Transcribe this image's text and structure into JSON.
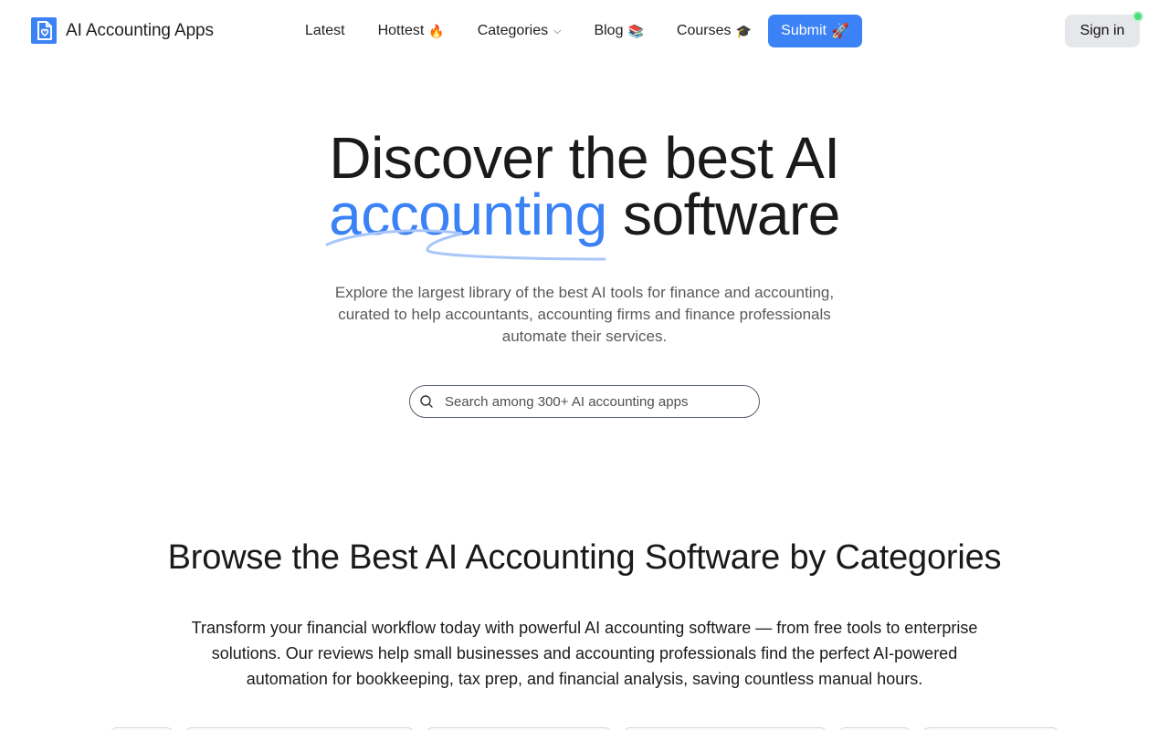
{
  "brand": {
    "name": "AI Accounting Apps",
    "accent": "#3b82f6"
  },
  "nav": {
    "items": [
      {
        "label": "Latest",
        "emoji": ""
      },
      {
        "label": "Hottest",
        "emoji": "🔥"
      },
      {
        "label": "Categories",
        "emoji": ""
      },
      {
        "label": "Blog",
        "emoji": "📚"
      },
      {
        "label": "Courses",
        "emoji": "🎓"
      }
    ],
    "submit_label": "Submit",
    "submit_emoji": "🚀",
    "signin_label": "Sign in"
  },
  "hero": {
    "title_line1": "Discover the best AI",
    "title_accent": "accounting",
    "title_rest": "software",
    "subtitle": "Explore the largest library of the best AI tools for finance and accounting, curated to help accountants, accounting firms and finance professionals automate their services."
  },
  "search": {
    "placeholder": "Search among 300+ AI accounting apps"
  },
  "categories": {
    "title": "Browse the Best AI Accounting Software by Categories",
    "description": "Transform your financial workflow today with powerful AI accounting software — from free tools to enterprise solutions. Our reviews help small businesses and accounting professionals find the perfect AI-powered automation for bookkeeping, tax prep, and financial analysis, saving countless manual hours."
  }
}
